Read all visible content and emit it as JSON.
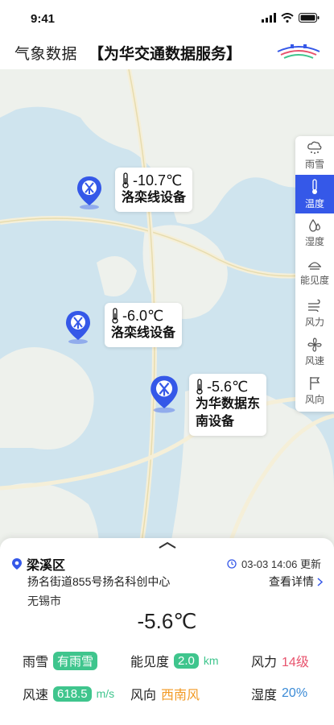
{
  "status_bar": {
    "time": "9:41"
  },
  "header": {
    "title": "气象数据",
    "subtitle": "【为华交通数据服务】"
  },
  "side_menu": [
    {
      "label": "雨雪",
      "icon": "rain-snow-icon",
      "active": false
    },
    {
      "label": "温度",
      "icon": "thermometer-icon",
      "active": true
    },
    {
      "label": "湿度",
      "icon": "humidity-icon",
      "active": false
    },
    {
      "label": "能见度",
      "icon": "visibility-icon",
      "active": false
    },
    {
      "label": "风力",
      "icon": "wind-force-icon",
      "active": false
    },
    {
      "label": "风速",
      "icon": "fan-icon",
      "active": false
    },
    {
      "label": "风向",
      "icon": "flag-icon",
      "active": false
    }
  ],
  "markers": [
    {
      "temp": "-10.7℃",
      "name": "洛栾线设备",
      "name2": ""
    },
    {
      "temp": "-6.0℃",
      "name": "洛栾线设备",
      "name2": ""
    },
    {
      "temp": "-5.6℃",
      "name": "为华数据东",
      "name2": "南设备"
    }
  ],
  "panel": {
    "district": "梁溪区",
    "update_time": "03-03 14:06 更新",
    "address": "扬名街道855号扬名科创中心",
    "detail_link": "查看详情",
    "city": "无锡市",
    "temperature": "-5.6℃",
    "metrics": {
      "rain_label": "雨雪",
      "rain_value": "有雨雪",
      "visibility_label": "能见度",
      "visibility_value": "2.0",
      "visibility_unit": "km",
      "wind_force_label": "风力",
      "wind_force_value": "14级",
      "wind_speed_label": "风速",
      "wind_speed_value": "618.5",
      "wind_speed_unit": "m/s",
      "wind_dir_label": "风向",
      "wind_dir_value": "西南风",
      "humidity_label": "湿度",
      "humidity_value": "20%"
    }
  },
  "colors": {
    "accent": "#3558e8",
    "badge_green": "#3fc58d",
    "red": "#e8546e",
    "orange": "#f29a24",
    "blue": "#3a8ad6"
  }
}
